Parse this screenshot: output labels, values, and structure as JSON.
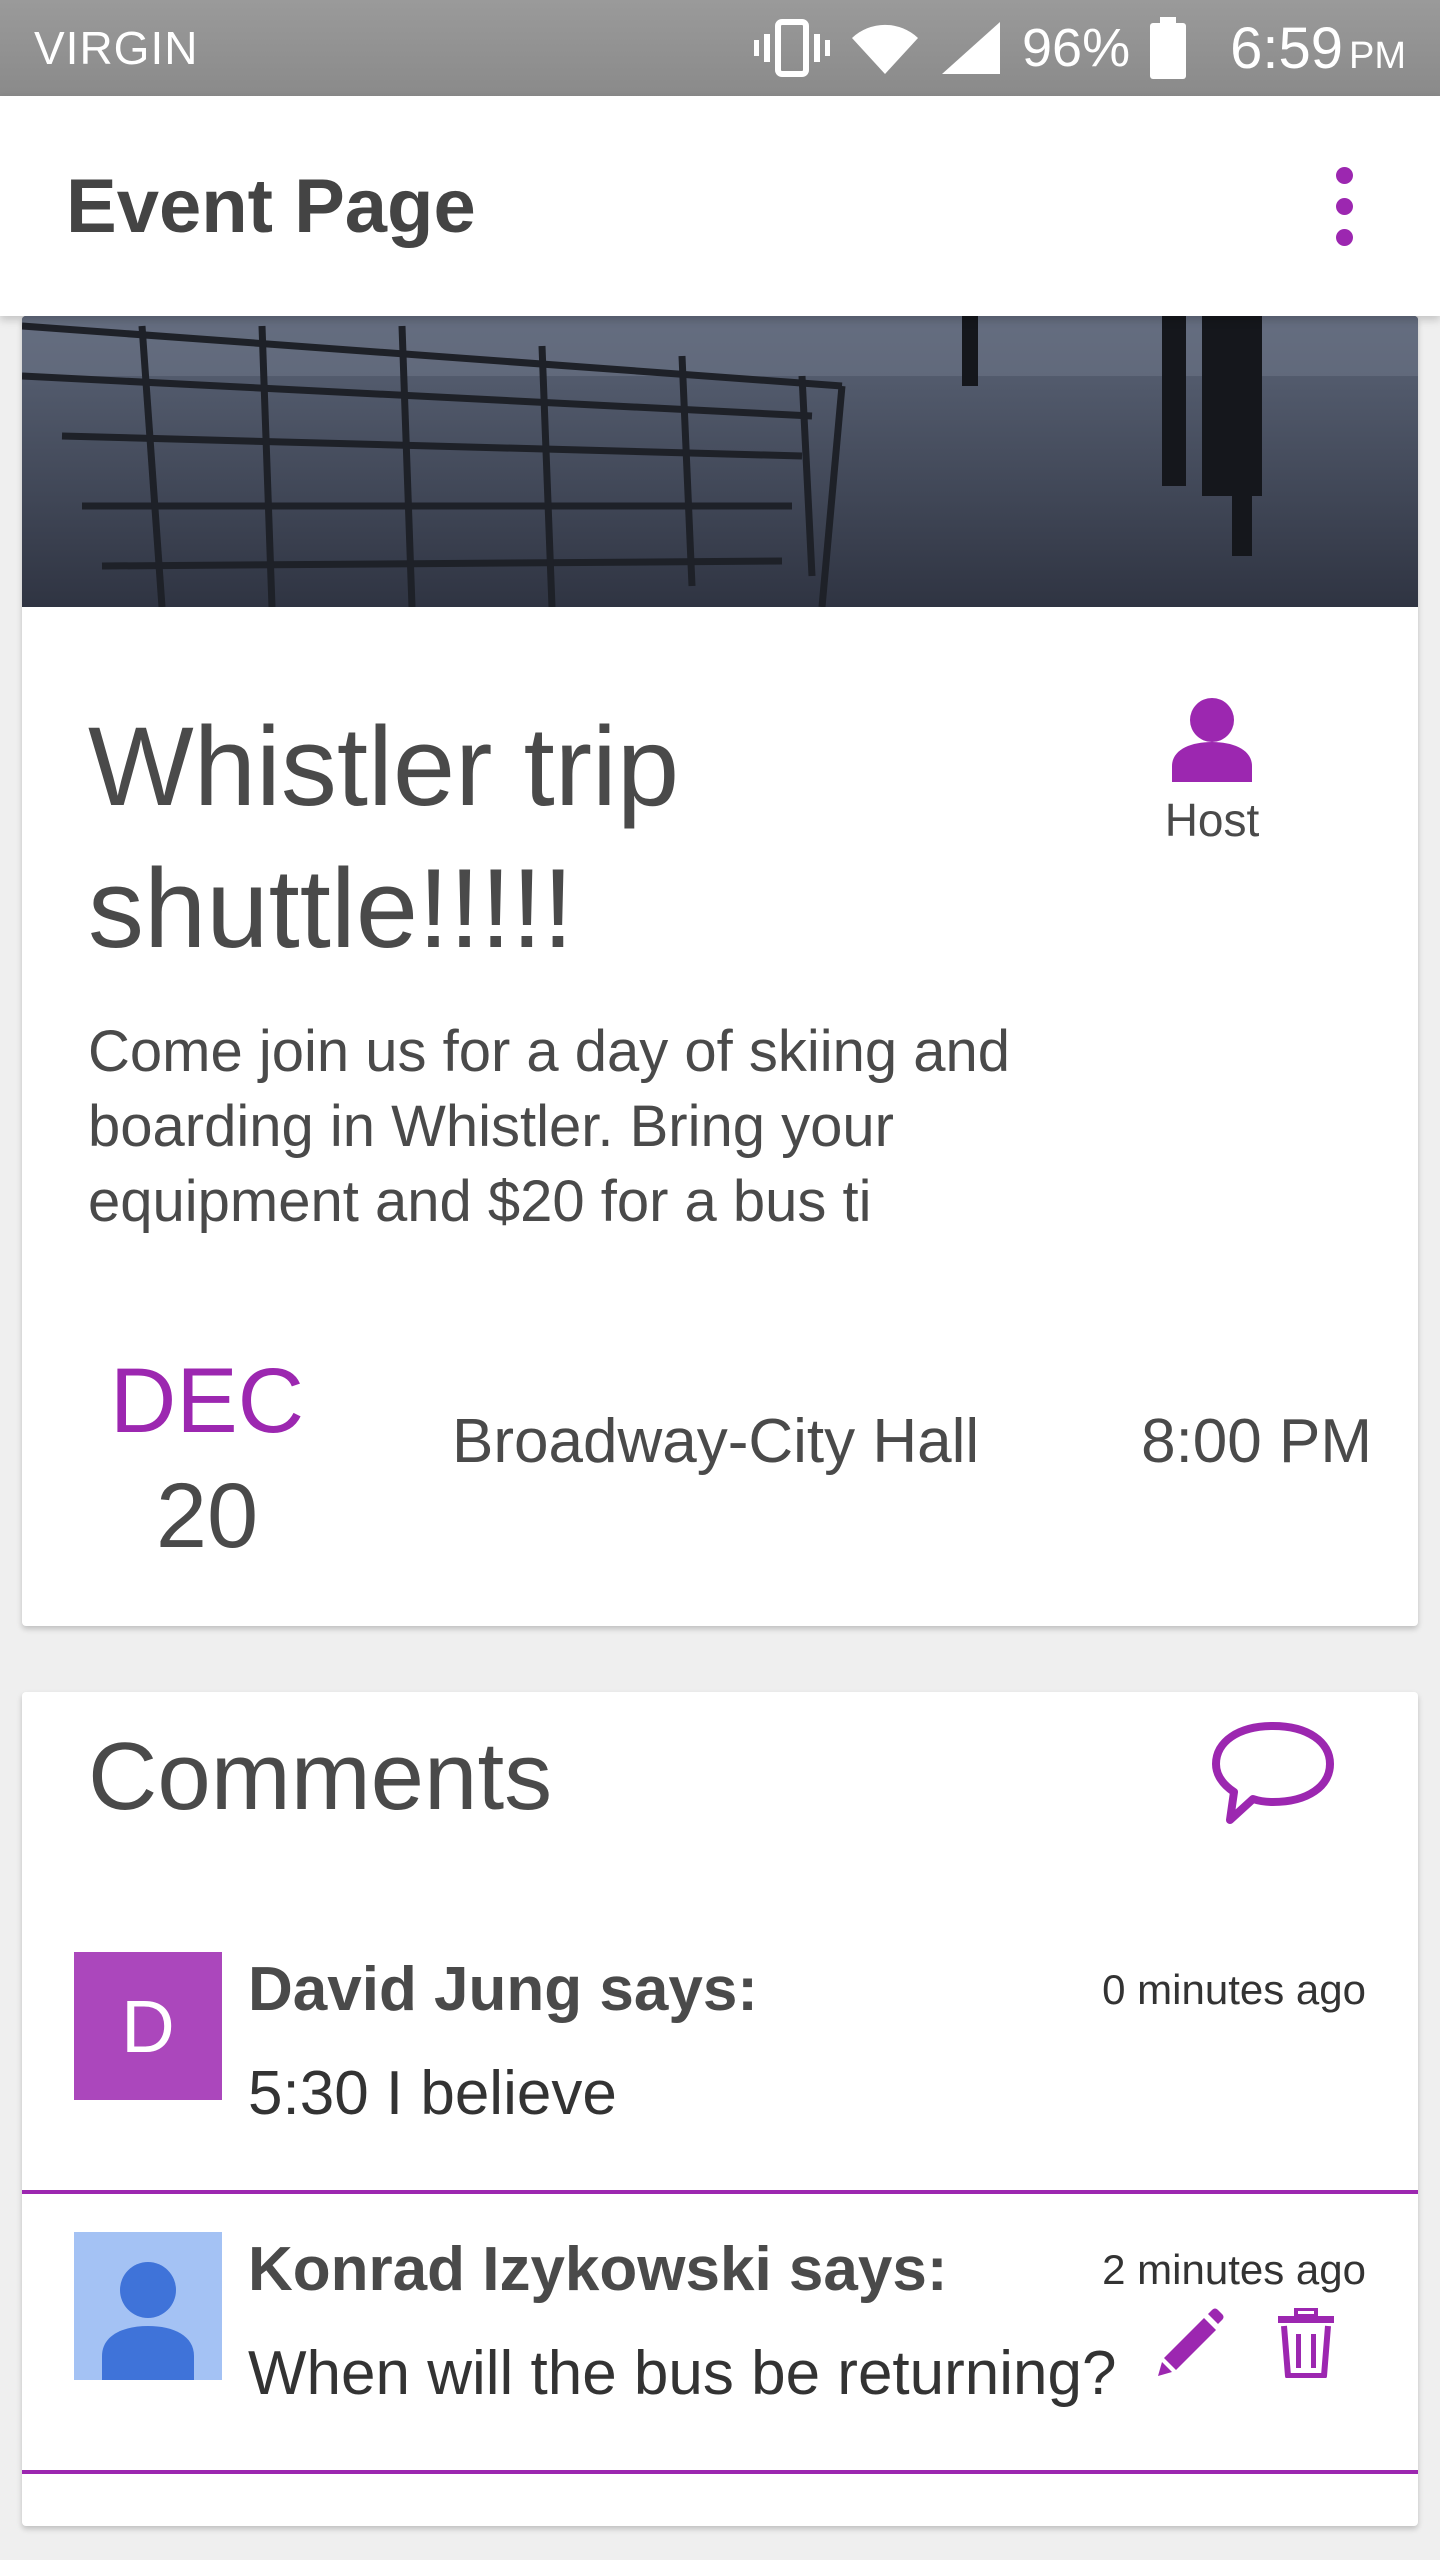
{
  "status_bar": {
    "carrier": "VIRGIN",
    "battery_pct": "96%",
    "time": "6:59",
    "ampm": "PM"
  },
  "app_bar": {
    "title": "Event Page"
  },
  "event": {
    "title": "Whistler trip shuttle!!!!!",
    "host_label": "Host",
    "description": "Come join us for a day of skiing and boarding in Whistler. Bring your equipment and $20 for a bus ti",
    "date_month": "DEC",
    "date_day": "20",
    "location": "Broadway-City Hall",
    "time": "8:00 PM"
  },
  "comments": {
    "title": "Comments",
    "items": [
      {
        "avatar_letter": "D",
        "author": "David Jung says:",
        "time_ago": "0 minutes ago",
        "text": "5:30 I believe"
      },
      {
        "author": "Konrad Izykowski says:",
        "time_ago": "2 minutes ago",
        "text": "When will the bus be returning?"
      }
    ]
  },
  "colors": {
    "accent": "#9c27b0",
    "avatar_letter_bg": "#ab47bc",
    "avatar_person_bg": "#a4c2f4",
    "avatar_person_fg": "#3f73d9",
    "status_bar": "#8f8f8f",
    "text": "#4a4a4a"
  },
  "icons": {
    "overflow": "more-vert-icon",
    "host": "person-icon",
    "add_comment": "speech-bubble-icon",
    "edit": "pencil-icon",
    "delete": "trash-icon"
  }
}
